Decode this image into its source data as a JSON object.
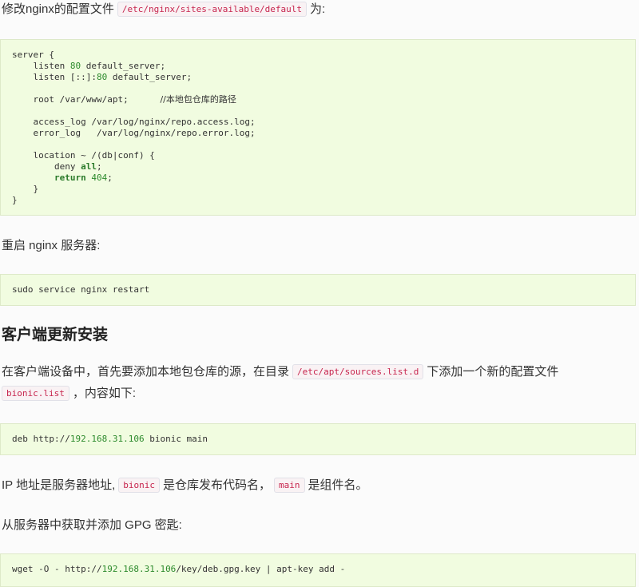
{
  "intro": {
    "text1": "修改nginx的配置文件",
    "code": "/etc/nginx/sites-available/default",
    "text2": "为:"
  },
  "server_block": {
    "l1": "server {",
    "l2a": "    listen ",
    "l2b": "80",
    "l2c": " default_server;",
    "l3a": "    listen [::]:",
    "l3b": "80",
    "l3c": " default_server;",
    "l5a": "    root /var/www/apt;      ",
    "l5b": "//本地包仓库的路径",
    "l7": "    access_log /var/log/nginx/repo.access.log;",
    "l8": "    error_log   /var/log/nginx/repo.error.log;",
    "l10": "    location ~ /(db|conf) {",
    "l11a": "        deny ",
    "l11b": "all",
    "l11c": ";",
    "l12a": "        ",
    "l12b": "return",
    "l12c": " ",
    "l12d": "404",
    "l12e": ";",
    "l13": "    }",
    "l14": "}"
  },
  "restart_text": "重启 nginx 服务器:",
  "restart_cmd": "sudo service nginx restart",
  "heading": "客户端更新安装",
  "client_para": {
    "text1": "在客户端设备中，首先要添加本地包仓库的源，在目录",
    "code1": "/etc/apt/sources.list.d",
    "text2": "下添加一个新的配置文件",
    "code2": "bionic.list",
    "text3": "，内容如下:"
  },
  "deb_line": {
    "a": "deb http://",
    "b": "192.168.31.106",
    "c": " bionic main"
  },
  "ip_para": {
    "text1": "IP 地址是服务器地址,",
    "code1": "bionic",
    "text2": "是仓库发布代码名，",
    "code2": "main",
    "text3": "是组件名。"
  },
  "gpg_text": "从服务器中获取并添加 GPG 密匙:",
  "wget_line": {
    "a": "wget -O - http://",
    "b": "192.168.31.106",
    "c": "/key/deb.gpg.key | apt-key add -"
  }
}
